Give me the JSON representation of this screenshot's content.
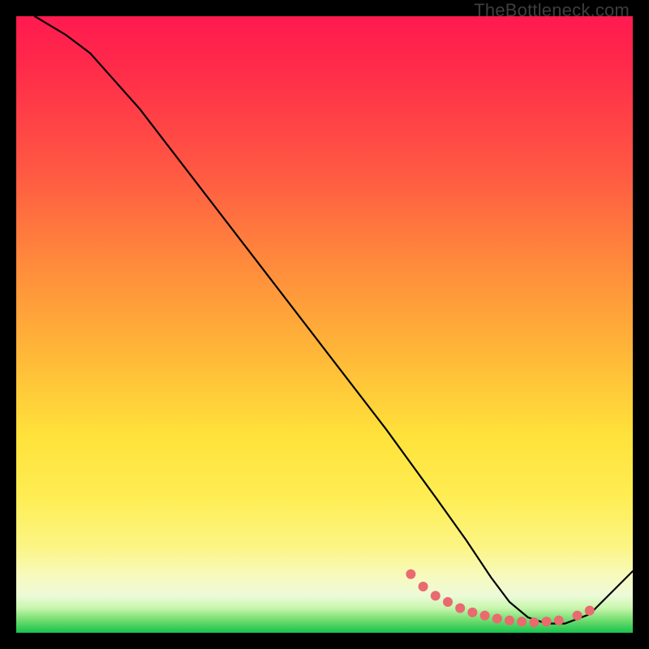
{
  "watermark": "TheBottleneck.com",
  "chart_data": {
    "type": "line",
    "title": "",
    "xlabel": "",
    "ylabel": "",
    "xlim": [
      0,
      100
    ],
    "ylim": [
      0,
      100
    ],
    "series": [
      {
        "name": "curve",
        "x": [
          3,
          8,
          12,
          20,
          30,
          40,
          50,
          60,
          68,
          73,
          77,
          80,
          83,
          86,
          89,
          93,
          100
        ],
        "y": [
          100,
          97,
          94,
          85,
          72,
          59,
          46,
          33,
          22,
          15,
          9,
          5,
          2.5,
          1.5,
          1.5,
          3,
          10
        ]
      }
    ],
    "markers": {
      "name": "highlight-dots",
      "color": "#e96a6f",
      "x": [
        64,
        66,
        68,
        70,
        72,
        74,
        76,
        78,
        80,
        82,
        84,
        86,
        88,
        91,
        93
      ],
      "y": [
        9.5,
        7.5,
        6,
        5,
        4,
        3.3,
        2.8,
        2.3,
        2,
        1.8,
        1.7,
        1.8,
        2,
        2.8,
        3.6
      ]
    }
  }
}
